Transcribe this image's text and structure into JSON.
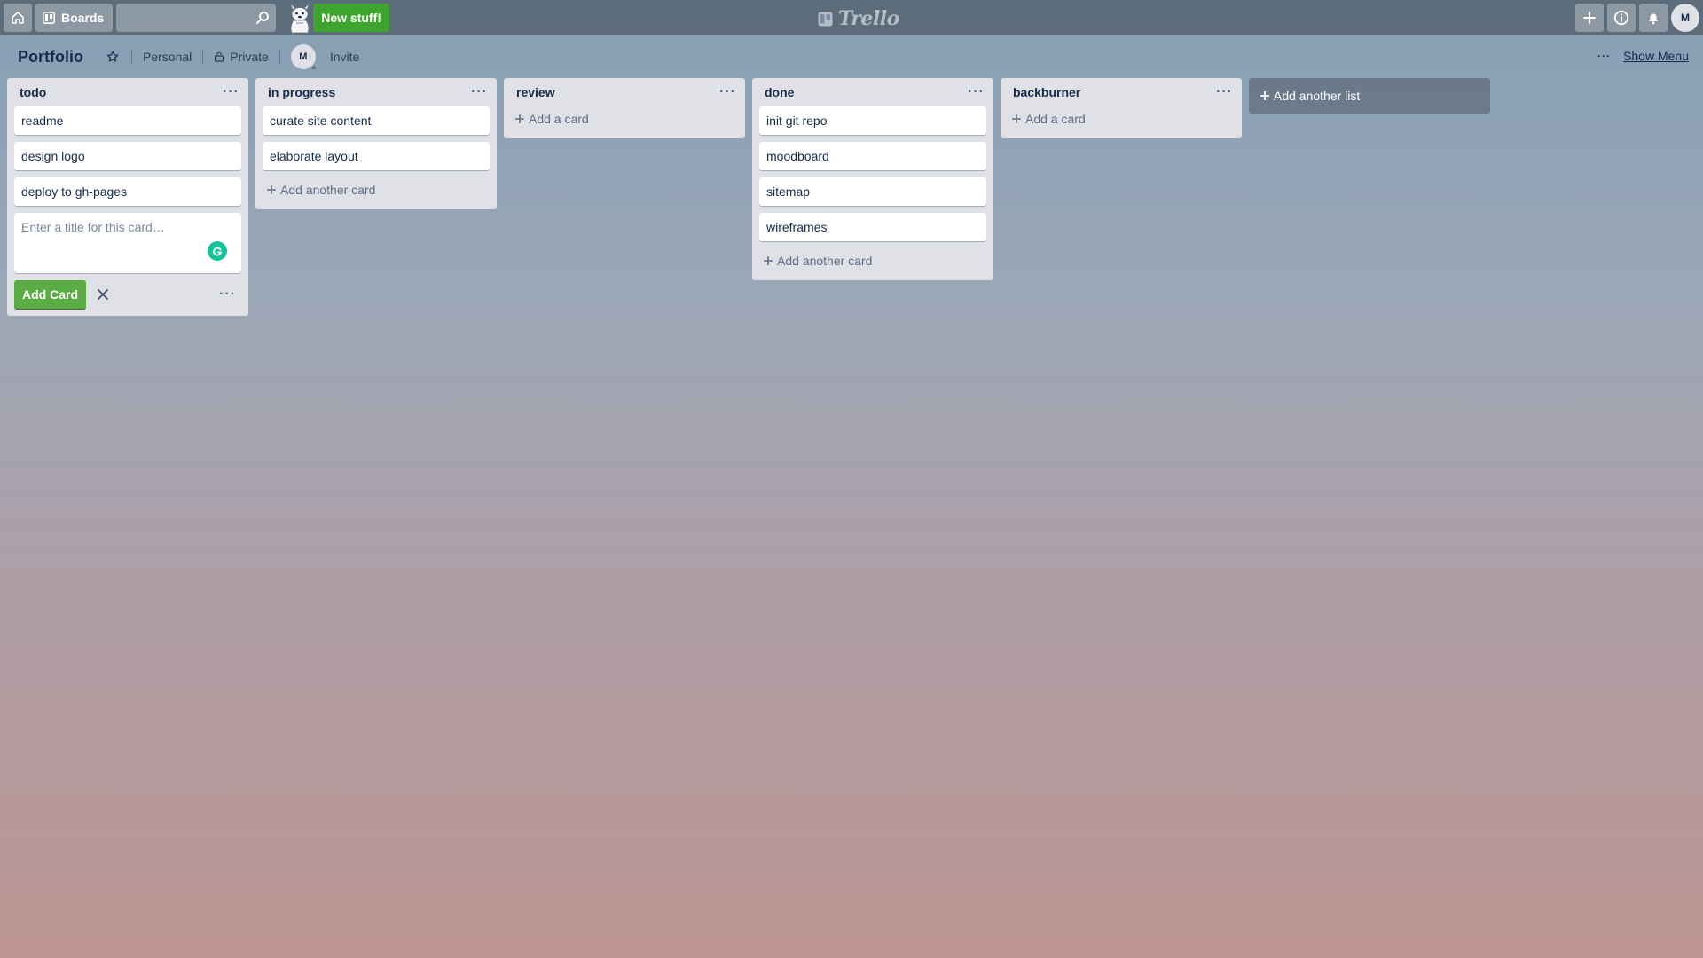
{
  "header": {
    "home_icon": "home-icon",
    "boards_label": "Boards",
    "search_placeholder": "",
    "new_stuff_label": "New stuff!",
    "logo_text": "Trello",
    "create_icon": "plus-icon",
    "info_icon": "info-icon",
    "notifications_icon": "bell-icon",
    "avatar_initial": "M"
  },
  "board": {
    "title": "Portfolio",
    "team": "Personal",
    "visibility": "Private",
    "member_initial": "M",
    "invite_label": "Invite",
    "show_menu_label": "Show Menu",
    "menu_dots": "···"
  },
  "lists": [
    {
      "title": "todo",
      "cards": [
        "readme",
        "design logo",
        "deploy to gh-pages"
      ],
      "composer": {
        "placeholder": "Enter a title for this card…",
        "add_button": "Add Card"
      }
    },
    {
      "title": "in progress",
      "cards": [
        "curate site content",
        "elaborate layout"
      ],
      "add_label": "Add another card"
    },
    {
      "title": "review",
      "cards": [],
      "add_label": "Add a card"
    },
    {
      "title": "done",
      "cards": [
        "init git repo",
        "moodboard",
        "sitemap",
        "wireframes"
      ],
      "add_label": "Add another card"
    },
    {
      "title": "backburner",
      "cards": [],
      "add_label": "Add a card"
    }
  ],
  "add_list_label": "Add another list",
  "colors": {
    "header_bg": "rgba(0,0,0,0.32)",
    "list_bg": "#dfe1e6",
    "add_button": "#5aac44",
    "new_stuff": "#3fa42d",
    "grammarly": "#15c39a"
  }
}
